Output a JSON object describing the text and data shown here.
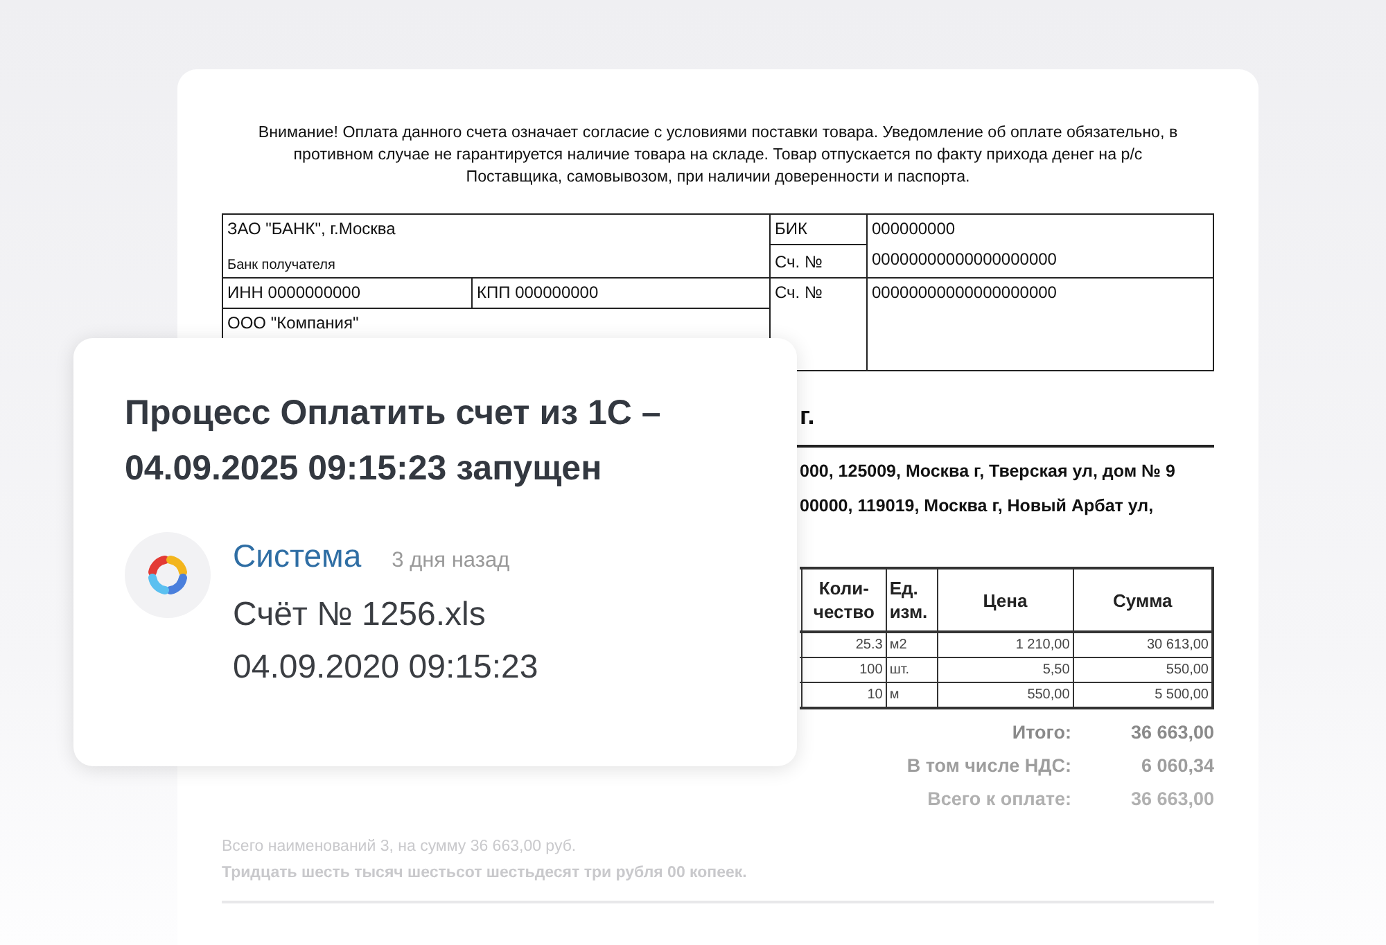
{
  "document": {
    "notice": [
      "Внимание! Оплата данного счета означает согласие с условиями поставки товара. Уведомление об оплате обязательно, в",
      "противном случае не гарантируется наличие товара на складе. Товар отпускается по факту прихода денег на р/с",
      "Поставщика, самовывозом, при наличии доверенности и паспорта."
    ],
    "bank_details": {
      "bank": "ЗАО \"БАНК\", г.Москва",
      "bank_caption": "Банк получателя",
      "inn": "ИНН 0000000000",
      "kpp": "КПП 000000000",
      "recipient": "ООО \"Компания\"",
      "bik_label": "БИК",
      "bik": "000000000",
      "account_label_1": "Сч. №",
      "account_1": "00000000000000000000",
      "account_label_2": "Сч. №",
      "account_2": "00000000000000000000"
    },
    "heading": "г.",
    "addresses": [
      "000, 125009, Москва г, Тверская ул, дом № 9",
      "00000, 119019, Москва г, Новый Арбат ул,"
    ],
    "items_table": {
      "columns": [
        "Коли-\nчество",
        "Ед.\nизм.",
        "Цена",
        "Сумма"
      ],
      "rows": [
        [
          "25.3",
          "м2",
          "1 210,00",
          "30 613,00"
        ],
        [
          "100",
          "шт.",
          "5,50",
          "550,00"
        ],
        [
          "10",
          "м",
          "550,00",
          "5 500,00"
        ]
      ]
    },
    "totals": [
      {
        "label": "Итого:",
        "value": "36 663,00"
      },
      {
        "label": "В том числе НДС:",
        "value": "6 060,34"
      },
      {
        "label": "Всего к оплате:",
        "value": "36 663,00"
      }
    ],
    "summary": [
      {
        "text": "Всего наименований 3, на сумму 36 663,00 руб.",
        "bold": false
      },
      {
        "text": "Тридцать шесть тысяч шестьсот шестьдесят три рубля 00 копеек.",
        "bold": true
      }
    ]
  },
  "notification": {
    "title": "Процесс Оплатить счет из 1С – 04.09.2025 09:15:23 запущен",
    "author": "Система",
    "time": "3 дня назад",
    "lines": [
      "Счёт № 1256.xls",
      "04.09.2020 09:15:23"
    ]
  }
}
